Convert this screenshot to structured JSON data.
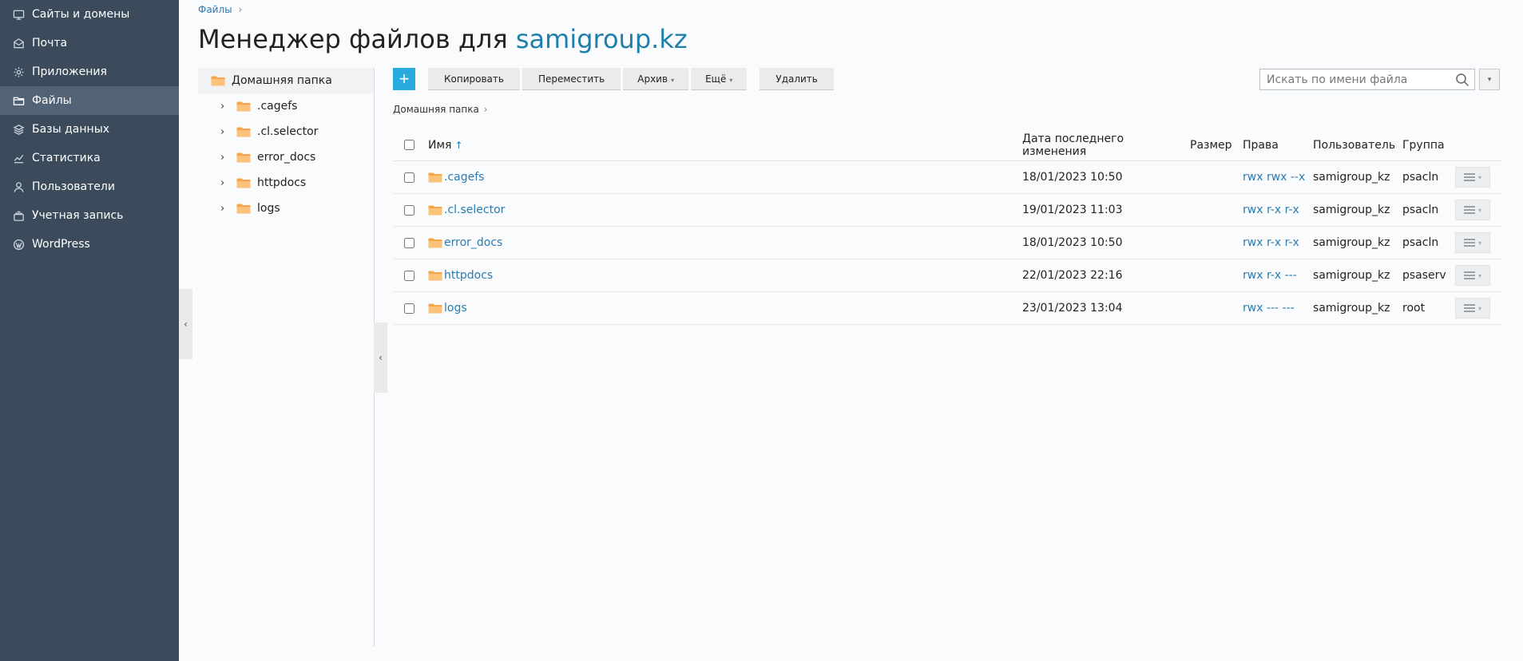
{
  "sidebar": {
    "items": [
      {
        "label": "Сайты и домены",
        "icon": "monitor-icon"
      },
      {
        "label": "Почта",
        "icon": "mail-icon"
      },
      {
        "label": "Приложения",
        "icon": "gear-icon"
      },
      {
        "label": "Файлы",
        "icon": "folder-icon",
        "active": true
      },
      {
        "label": "Базы данных",
        "icon": "database-icon"
      },
      {
        "label": "Статистика",
        "icon": "chart-icon"
      },
      {
        "label": "Пользователи",
        "icon": "user-icon"
      },
      {
        "label": "Учетная запись",
        "icon": "account-icon"
      },
      {
        "label": "WordPress",
        "icon": "wordpress-icon"
      }
    ]
  },
  "breadcrumb": {
    "root": "Файлы"
  },
  "title": {
    "prefix": "Менеджер файлов для",
    "domain": "samigroup.kz"
  },
  "tree": {
    "root": "Домашняя папка",
    "items": [
      ".cagefs",
      ".cl.selector",
      "error_docs",
      "httpdocs",
      "logs"
    ]
  },
  "toolbar": {
    "add": "+",
    "copy": "Копировать",
    "move": "Переместить",
    "archive": "Архив",
    "more": "Ещё",
    "delete": "Удалить"
  },
  "search": {
    "placeholder": "Искать по имени файла"
  },
  "current_path": "Домашняя папка",
  "table": {
    "headers": {
      "name": "Имя",
      "modified": "Дата последнего изменения",
      "size": "Размер",
      "perms": "Права",
      "user": "Пользователь",
      "group": "Группа"
    },
    "rows": [
      {
        "name": ".cagefs",
        "modified": "18/01/2023 10:50",
        "size": "",
        "perms": "rwx rwx --x",
        "user": "samigroup_kz",
        "group": "psacln"
      },
      {
        "name": ".cl.selector",
        "modified": "19/01/2023 11:03",
        "size": "",
        "perms": "rwx r-x r-x",
        "user": "samigroup_kz",
        "group": "psacln"
      },
      {
        "name": "error_docs",
        "modified": "18/01/2023 10:50",
        "size": "",
        "perms": "rwx r-x r-x",
        "user": "samigroup_kz",
        "group": "psacln"
      },
      {
        "name": "httpdocs",
        "modified": "22/01/2023 22:16",
        "size": "",
        "perms": "rwx r-x ---",
        "user": "samigroup_kz",
        "group": "psaserv"
      },
      {
        "name": "logs",
        "modified": "23/01/2023 13:04",
        "size": "",
        "perms": "rwx --- ---",
        "user": "samigroup_kz",
        "group": "root"
      }
    ]
  },
  "colors": {
    "sidebar_bg": "#3b4b5c",
    "sidebar_active": "#526376",
    "accent": "#28aade",
    "link": "#2b7bb0",
    "folder": "#f5a54a"
  }
}
